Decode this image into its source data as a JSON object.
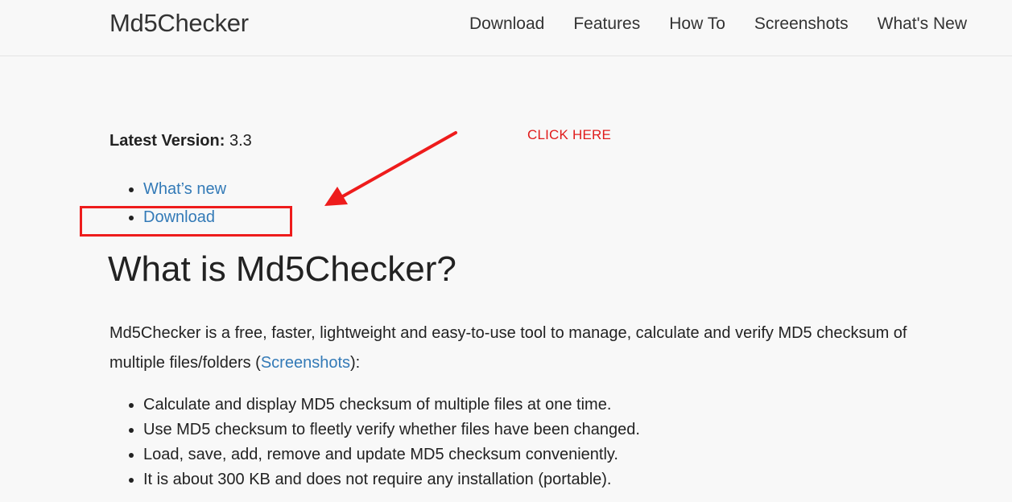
{
  "navbar": {
    "brand": "Md5Checker",
    "links": [
      "Download",
      "Features",
      "How To",
      "Screenshots",
      "What's New"
    ]
  },
  "latest": {
    "label": "Latest Version:",
    "value": "3.3"
  },
  "quick_links": [
    "What’s new",
    "Download"
  ],
  "annotation": {
    "callout_text": "CLICK HERE",
    "color": "#e01b1b"
  },
  "main": {
    "heading": "What is Md5Checker?",
    "intro_before": "Md5Checker is a free, faster, lightweight and easy-to-use tool to manage, calculate and verify MD5 checksum of multiple files/folders (",
    "intro_link": "Screenshots",
    "intro_after": "):",
    "features": [
      "Calculate and display MD5 checksum of multiple files at one time.",
      "Use MD5 checksum to fleetly verify whether files have been changed.",
      "Load, save, add, remove and update MD5 checksum conveniently.",
      "It is about 300 KB and does not require any installation (portable)."
    ]
  },
  "colors": {
    "link": "#337ab7",
    "annotation_red": "#ee1c1c"
  }
}
